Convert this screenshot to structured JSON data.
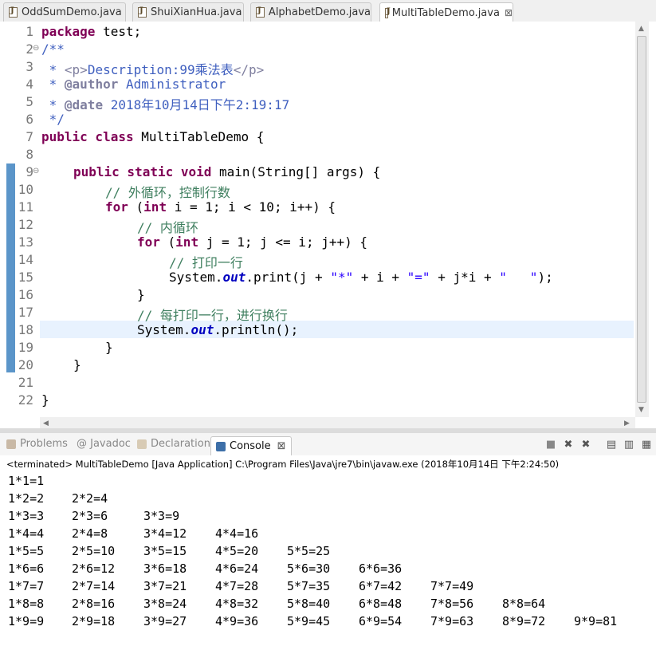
{
  "editor_tabs": [
    {
      "label": "OddSumDemo.java"
    },
    {
      "label": "ShuiXianHua.java"
    },
    {
      "label": "AlphabetDemo.java"
    },
    {
      "label": "MultiTableDemo.java",
      "active": true
    }
  ],
  "editor": {
    "line_numbers": [
      "1",
      "2",
      "3",
      "4",
      "5",
      "6",
      "7",
      "8",
      "9",
      "10",
      "11",
      "12",
      "13",
      "14",
      "15",
      "16",
      "17",
      "18",
      "19",
      "20",
      "21",
      "22"
    ],
    "fold_markers": {
      "line2": "⊖",
      "line9": "⊖"
    },
    "code": {
      "l1_kw": "package",
      "l1_rest": " test;",
      "l2": "/**",
      "l3_a": " * ",
      "l3_tag": "<p>",
      "l3_b": "Description:99乘法表",
      "l3_tag2": "</p>",
      "l4_a": " * ",
      "l4_tag": "@author",
      "l4_b": " Administrator",
      "l5_a": " * ",
      "l5_tag": "@date",
      "l5_b": " 2018年10月14日下午2:19:17",
      "l6": " */",
      "l7_kw": "public class",
      "l7_rest": " MultiTableDemo {",
      "l9_kw": "public static void",
      "l9_rest": " main(String[] args) {",
      "l10": "// 外循环，控制行数",
      "l11_kw": "for",
      "l11_a": " (",
      "l11_kw2": "int",
      "l11_b": " i = 1; i < 10; i++) {",
      "l12": "// 内循环",
      "l13_kw": "for",
      "l13_a": " (",
      "l13_kw2": "int",
      "l13_b": " j = 1; j <= i; j++) {",
      "l14": "// 打印一行",
      "l15_a": "System.",
      "l15_out": "out",
      "l15_b": ".print(j + ",
      "l15_s1": "\"*\"",
      "l15_c": " + i + ",
      "l15_s2": "\"=\"",
      "l15_d": " + j*i + ",
      "l15_s3": "\"   \"",
      "l15_e": ");",
      "l16": "}",
      "l17": "// 每打印一行，进行换行",
      "l18_a": "System.",
      "l18_out": "out",
      "l18_b": ".println();",
      "l19": "}",
      "l20": "}",
      "l22": "}"
    }
  },
  "views": {
    "tabs": [
      "Problems",
      "@ Javadoc",
      "Declaration",
      "Console"
    ],
    "console_close": "⊠"
  },
  "console": {
    "header": "<terminated> MultiTableDemo [Java Application] C:\\Program Files\\Java\\jre7\\bin\\javaw.exe (2018年10月14日 下午2:24:50)",
    "lines": [
      [
        "1*1=1"
      ],
      [
        "1*2=2",
        "2*2=4"
      ],
      [
        "1*3=3",
        "2*3=6",
        "3*3=9"
      ],
      [
        "1*4=4",
        "2*4=8",
        "3*4=12",
        "4*4=16"
      ],
      [
        "1*5=5",
        "2*5=10",
        "3*5=15",
        "4*5=20",
        "5*5=25"
      ],
      [
        "1*6=6",
        "2*6=12",
        "3*6=18",
        "4*6=24",
        "5*6=30",
        "6*6=36"
      ],
      [
        "1*7=7",
        "2*7=14",
        "3*7=21",
        "4*7=28",
        "5*7=35",
        "6*7=42",
        "7*7=49"
      ],
      [
        "1*8=8",
        "2*8=16",
        "3*8=24",
        "4*8=32",
        "5*8=40",
        "6*8=48",
        "7*8=56",
        "8*8=64"
      ],
      [
        "1*9=9",
        "2*9=18",
        "3*9=27",
        "4*9=36",
        "5*9=45",
        "6*9=54",
        "7*9=63",
        "8*9=72",
        "9*9=81"
      ]
    ]
  },
  "colors": {
    "keyword": "#7f0055",
    "comment": "#3f7f5f",
    "javadoc": "#3f5fbf",
    "string": "#2a00ff",
    "field": "#0000c0",
    "current_line": "#e8f2fe"
  }
}
